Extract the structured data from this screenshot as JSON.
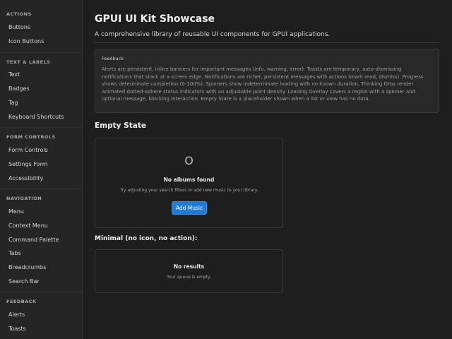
{
  "sidebar": {
    "sections": [
      {
        "header": "ACTIONS",
        "items": [
          "Buttons",
          "Icon Buttons"
        ]
      },
      {
        "header": "TEXT & LABELS",
        "items": [
          "Text",
          "Badges",
          "Tag",
          "Keyboard Shortcuts"
        ]
      },
      {
        "header": "FORM CONTROLS",
        "items": [
          "Form Controls",
          "Settings Form",
          "Accessibility"
        ]
      },
      {
        "header": "NAVIGATION",
        "items": [
          "Menu",
          "Context Menu",
          "Command Palette",
          "Tabs",
          "Breadcrumbs",
          "Search Bar"
        ]
      },
      {
        "header": "FEEDBACK",
        "items": [
          "Alerts",
          "Toasts"
        ]
      }
    ]
  },
  "header": {
    "title": "GPUI UI Kit Showcase",
    "subtitle": "A comprehensive library of reusable UI components for GPUI applications."
  },
  "feedback": {
    "label": "Feedback",
    "text": "Alerts are persistent, inline banners for important messages (info, warning, error). Toasts are temporary, auto-dismissing notifications that stack at a screen edge. Notifications are richer, persistent messages with actions (mark read, dismiss). Progress shows determinate completion (0-100%). Spinners show indeterminate loading with no known duration. Thinking Orbs render animated dotted-sphere status indicators with an adjustable point density. Loading Overlay covers a region with a spinner and optional message, blocking interaction. Empty State is a placeholder shown when a list or view has no data."
  },
  "empty_state": {
    "section_title": "Empty State",
    "icon_glyph": "O",
    "title": "No albums found",
    "description": "Try adjusting your search filters or add new music to your library.",
    "action_label": "Add Music"
  },
  "minimal": {
    "section_title": "Minimal (no icon, no action):",
    "title": "No results",
    "description": "Your queue is empty."
  },
  "colors": {
    "background": "#1e1e1e",
    "sidebar": "#252526",
    "accent": "#1f7bd4"
  }
}
